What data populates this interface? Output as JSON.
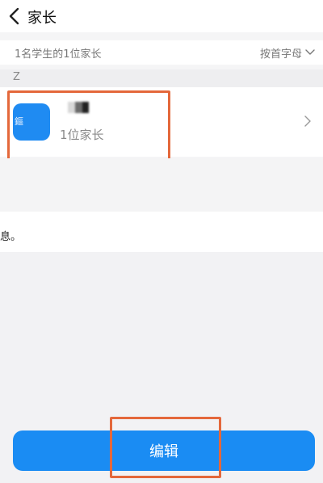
{
  "header": {
    "title": "家长",
    "back_icon": "chevron-left-icon"
  },
  "summary": {
    "text": "1名学生的1位家长",
    "sort_label": "按首字母",
    "sort_icon": "chevron-down-icon"
  },
  "section": {
    "letter": "Z"
  },
  "contact": {
    "avatar_text": "鏂",
    "subtitle": "1位家长",
    "chevron_icon": "chevron-right-icon"
  },
  "partial_text": "息。",
  "edit_button": {
    "label": "编辑"
  },
  "colors": {
    "accent": "#1a8cf3",
    "highlight": "#e4683b"
  }
}
